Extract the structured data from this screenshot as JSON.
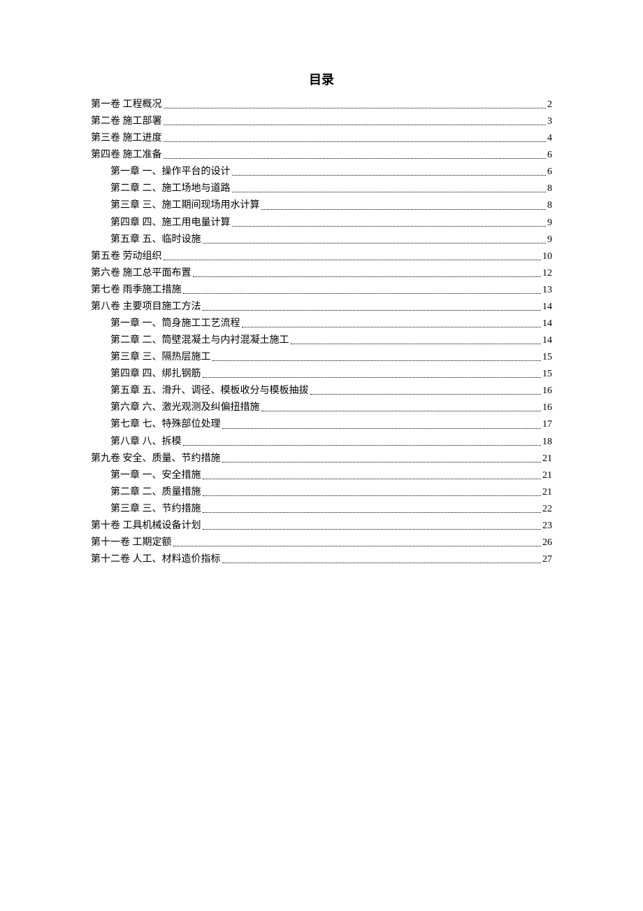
{
  "title": "目录",
  "entries": [
    {
      "level": 1,
      "label": "第一卷 工程概况",
      "page": "2"
    },
    {
      "level": 1,
      "label": "第二卷 施工部署",
      "page": "3"
    },
    {
      "level": 1,
      "label": "第三卷 施工进度",
      "page": "4"
    },
    {
      "level": 1,
      "label": "第四卷 施工准备",
      "page": "6"
    },
    {
      "level": 2,
      "label": "第一章 一、操作平台的设计",
      "page": "6"
    },
    {
      "level": 2,
      "label": "第二章 二、施工场地与道路",
      "page": "8"
    },
    {
      "level": 2,
      "label": "第三章 三、施工期间现场用水计算",
      "page": "8"
    },
    {
      "level": 2,
      "label": "第四章 四、施工用电量计算",
      "page": "9"
    },
    {
      "level": 2,
      "label": "第五章 五、临时设施",
      "page": "9"
    },
    {
      "level": 1,
      "label": "第五卷 劳动组织",
      "page": "10"
    },
    {
      "level": 1,
      "label": "第六卷 施工总平面布置",
      "page": "12"
    },
    {
      "level": 1,
      "label": "第七卷 雨季施工措施",
      "page": "13"
    },
    {
      "level": 1,
      "label": "第八卷 主要项目施工方法",
      "page": "14"
    },
    {
      "level": 2,
      "label": "第一章 一、筒身施工工艺流程",
      "page": "14"
    },
    {
      "level": 2,
      "label": "第二章 二、筒壁混凝土与内衬混凝土施工",
      "page": "14"
    },
    {
      "level": 2,
      "label": "第三章 三、隔热层施工",
      "page": "15"
    },
    {
      "level": 2,
      "label": "第四章 四、绑扎钢筋",
      "page": "15"
    },
    {
      "level": 2,
      "label": "第五章 五、滑升、调径、模板收分与模板抽拔",
      "page": "16"
    },
    {
      "level": 2,
      "label": "第六章 六、激光观测及纠偏扭措施",
      "page": "16"
    },
    {
      "level": 2,
      "label": "第七章 七、特殊部位处理",
      "page": "17"
    },
    {
      "level": 2,
      "label": "第八章 八、拆模",
      "page": "18"
    },
    {
      "level": 1,
      "label": "第九卷 安全、质量、节约措施",
      "page": "21"
    },
    {
      "level": 2,
      "label": "第一章 一、安全措施",
      "page": "21"
    },
    {
      "level": 2,
      "label": "第二章 二、质量措施",
      "page": "21"
    },
    {
      "level": 2,
      "label": "第三章 三、节约措施",
      "page": "22"
    },
    {
      "level": 1,
      "label": "第十卷 工具机械设备计划",
      "page": "23"
    },
    {
      "level": 1,
      "label": "第十一卷 工期定额",
      "page": "26"
    },
    {
      "level": 1,
      "label": "第十二卷 人工、材料造价指标",
      "page": "27"
    }
  ]
}
